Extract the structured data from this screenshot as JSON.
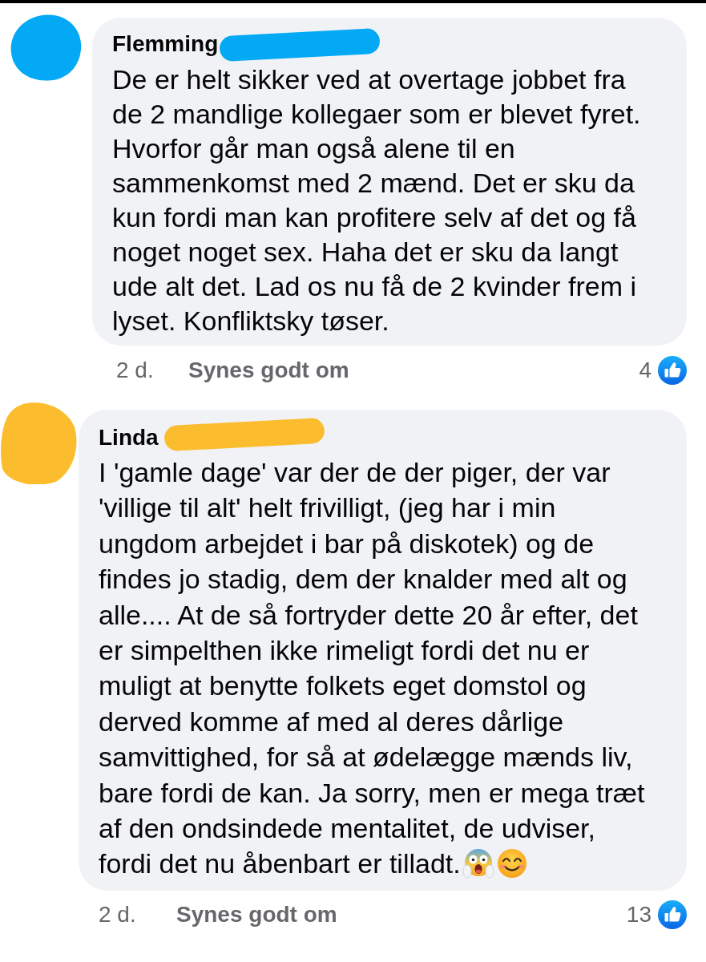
{
  "comments": [
    {
      "author": "Flemming",
      "color": "#03a9f4",
      "text": "De er helt sikker ved at overtage jobbet fra\nde 2 mandlige kollegaer som er blevet fyret.\nHvorfor går man også alene til en\nsammenkomst med 2 mænd. Det er sku da\nkun fordi man kan profitere selv af det og få\nnoget noget sex. Haha det er sku da langt\nude alt det. Lad os nu få de 2 kvinder frem i\nlyset. Konfliktsky tøser.",
      "time": "2 d.",
      "like_label": "Synes godt om",
      "reaction_count": "4"
    },
    {
      "author": "Linda",
      "color": "#fbbd2e",
      "text": "I 'gamle dage' var der de der piger, der var\n'villige til alt' helt frivilligt, (jeg har i min\nungdom arbejdet i bar på diskotek) og de\nfindes jo stadig, dem der knalder med alt og\nalle.... At de så fortryder dette 20 år efter, det\ner simpelthen ikke rimeligt fordi det nu er\nmuligt at benytte folkets eget domstol og\nderved komme af med al deres dårlige\nsamvittighed, for så at ødelægge mænds liv,\nbare fordi de kan. Ja sorry, men er mega træt\naf den ondsindede mentalitet, de udviser,",
      "last_line": "fordi det nu åbenbart er tilladt.",
      "emoji": [
        {
          "kind": "scream"
        },
        {
          "kind": "smile"
        }
      ],
      "time": "2 d.",
      "like_label": "Synes godt om",
      "reaction_count": "13"
    }
  ]
}
